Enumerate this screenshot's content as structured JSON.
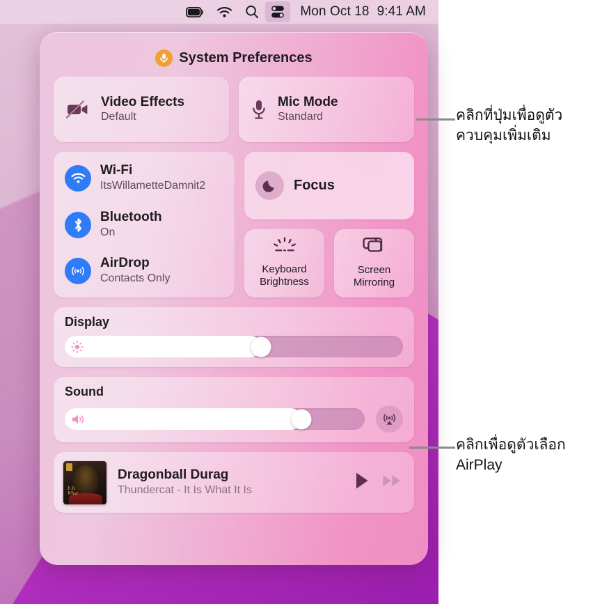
{
  "menubar": {
    "icons": [
      {
        "name": "battery-icon",
        "label": "Battery"
      },
      {
        "name": "wifi-icon",
        "label": "Wi-Fi"
      },
      {
        "name": "search-icon",
        "label": "Spotlight Search"
      },
      {
        "name": "control-center-icon",
        "label": "Control Center"
      }
    ],
    "date": "Mon Oct 18",
    "time": "9:41 AM"
  },
  "control_center": {
    "header": {
      "badge_icon": "microphone-icon",
      "badge_color": "#f0a030",
      "title": "System Preferences"
    },
    "media_tiles": [
      {
        "icon": "video-off-icon",
        "title": "Video Effects",
        "subtitle": "Default"
      },
      {
        "icon": "microphone-icon",
        "title": "Mic Mode",
        "subtitle": "Standard"
      }
    ],
    "network": [
      {
        "icon": "wifi-icon",
        "title": "Wi-Fi",
        "subtitle": "ItsWillametteDamnit2",
        "accent": "#2f7cf6"
      },
      {
        "icon": "bluetooth-icon",
        "title": "Bluetooth",
        "subtitle": "On",
        "accent": "#2f7cf6"
      },
      {
        "icon": "airdrop-icon",
        "title": "AirDrop",
        "subtitle": "Contacts Only",
        "accent": "#2f7cf6"
      }
    ],
    "focus": {
      "icon": "moon-icon",
      "label": "Focus"
    },
    "small_tiles": [
      {
        "icon": "keyboard-brightness-icon",
        "line1": "Keyboard",
        "line2": "Brightness"
      },
      {
        "icon": "screen-mirroring-icon",
        "line1": "Screen",
        "line2": "Mirroring"
      }
    ],
    "display": {
      "caption": "Display",
      "icon": "brightness-icon",
      "value_percent": 58
    },
    "sound": {
      "caption": "Sound",
      "icon": "speaker-icon",
      "value_percent": 79,
      "airplay_icon": "airplay-audio-icon"
    },
    "now_playing": {
      "track": "Dragonball Durag",
      "artist_album": "Thundercat - It Is What It Is",
      "artwork_alt": "It Is What It Is album cover",
      "controls": [
        {
          "name": "play-button",
          "icon": "play-icon"
        },
        {
          "name": "fast-forward-button",
          "icon": "fast-forward-icon"
        }
      ]
    }
  },
  "annotations": [
    {
      "text": "คลิกที่ปุ่มเพื่อดูตัวควบคุมเพิ่มเติม"
    },
    {
      "text": "คลิกเพื่อดูตัวเลือก AirPlay"
    }
  ]
}
